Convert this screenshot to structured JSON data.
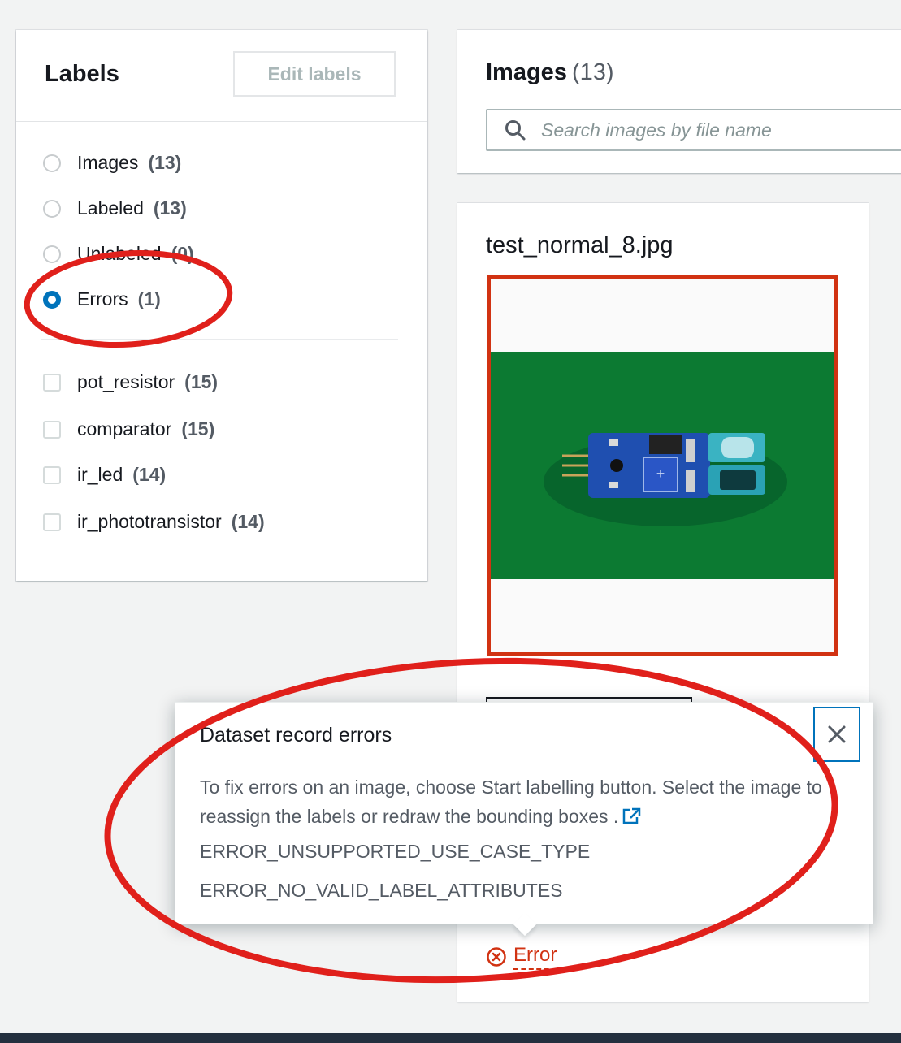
{
  "labels_panel": {
    "title": "Labels",
    "edit_button": "Edit labels",
    "filters": [
      {
        "label": "Images",
        "count": "(13)",
        "checked": false
      },
      {
        "label": "Labeled",
        "count": "(13)",
        "checked": false
      },
      {
        "label": "Unlabeled",
        "count": "(0)",
        "checked": false
      },
      {
        "label": "Errors",
        "count": "(1)",
        "checked": true
      }
    ],
    "labels": [
      {
        "label": "pot_resistor",
        "count": "(15)"
      },
      {
        "label": "comparator",
        "count": "(15)"
      },
      {
        "label": "ir_led",
        "count": "(14)"
      },
      {
        "label": "ir_phototransistor",
        "count": "(14)"
      }
    ]
  },
  "images_panel": {
    "title": "Images",
    "count": "(13)",
    "search_placeholder": "Search images by file name"
  },
  "image_card": {
    "file_name": "test_normal_8.jpg",
    "status": "Error"
  },
  "popover": {
    "title": "Dataset record errors",
    "body": "To fix errors on an image, choose Start labelling button. Select the image to reassign the labels or redraw the bounding boxes .",
    "errors": [
      "ERROR_UNSUPPORTED_USE_CASE_TYPE",
      "ERROR_NO_VALID_LABEL_ATTRIBUTES"
    ]
  },
  "icons": [
    "search-icon",
    "close-icon",
    "external-link-icon",
    "error-icon"
  ],
  "colors": {
    "accent": "#0073bb",
    "error": "#d13212",
    "annotation": "#e0201b"
  }
}
